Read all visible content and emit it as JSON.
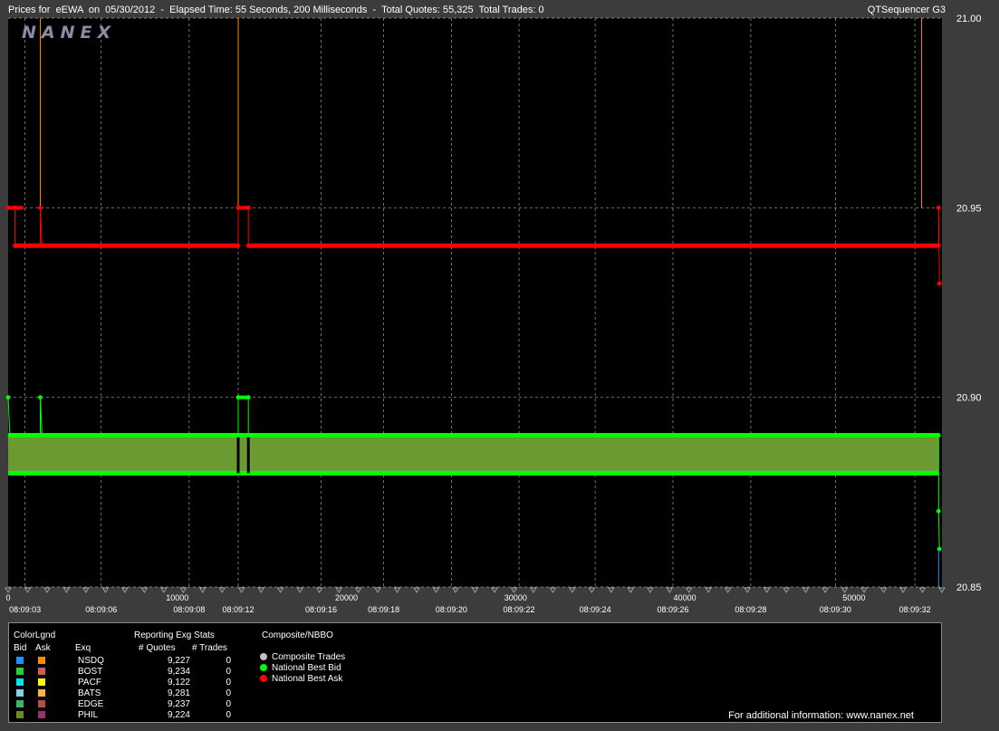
{
  "header": {
    "title": "Prices for  eEWA  on  05/30/2012  -  Elapsed Time: 55 Seconds, 200 Milliseconds  -  Total Quotes: 55,325  Total Trades: 0",
    "app_name": "QTSequencer G3",
    "watermark": "NANEX"
  },
  "colors": {
    "background": "#000000",
    "frame": "#3c3c3c",
    "bid_line": "#00ff00",
    "ask_line": "#ff0000",
    "spread_fill": "#6b9a32",
    "ask_spike": "#ff8c00",
    "grid": "#a0a0a0"
  },
  "chart_data": {
    "type": "line",
    "title": "",
    "xlabel": "",
    "ylabel": "",
    "x_range": [
      0,
      55200
    ],
    "ylim": [
      20.85,
      21.0
    ],
    "y_ticks": [
      "21.00",
      "20.95",
      "20.90",
      "20.85"
    ],
    "x_ticks_numeric": [
      0,
      10000,
      20000,
      30000,
      40000,
      50000
    ],
    "x_time_labels": [
      "08:09:03",
      "08:09:06",
      "08:09:08",
      "08:09:12",
      "08:09:16",
      "08:09:18",
      "08:09:20",
      "08:09:22",
      "08:09:24",
      "08:09:26",
      "08:09:28",
      "08:09:30",
      "08:09:32"
    ],
    "x_time_label_ms": [
      1000,
      5500,
      10700,
      13600,
      18500,
      22200,
      26200,
      30200,
      34700,
      39300,
      43900,
      48900,
      53600
    ],
    "grid": true,
    "series": [
      {
        "name": "National Best Ask",
        "color": "#ff0000",
        "points": [
          [
            0,
            20.95
          ],
          [
            400,
            20.95
          ],
          [
            400,
            20.94
          ],
          [
            1900,
            20.94
          ],
          [
            1900,
            20.95
          ],
          [
            2000,
            20.94
          ],
          [
            13600,
            20.94
          ],
          [
            13600,
            20.95
          ],
          [
            14200,
            20.95
          ],
          [
            14200,
            20.94
          ],
          [
            55000,
            20.94
          ],
          [
            55000,
            20.95
          ],
          [
            55050,
            20.93
          ]
        ]
      },
      {
        "name": "National Best Bid",
        "color": "#00ff00",
        "points": [
          [
            0,
            20.9
          ],
          [
            100,
            20.89
          ],
          [
            1900,
            20.89
          ],
          [
            1900,
            20.9
          ],
          [
            2000,
            20.89
          ],
          [
            13600,
            20.89
          ],
          [
            13600,
            20.9
          ],
          [
            14200,
            20.9
          ],
          [
            14200,
            20.89
          ],
          [
            55000,
            20.89
          ],
          [
            55000,
            20.87
          ],
          [
            55050,
            20.86
          ]
        ]
      },
      {
        "name": "Ask quote spikes",
        "color": "#ff8c00",
        "values_ms": [
          1900,
          13600,
          54000
        ]
      }
    ],
    "spread_band": {
      "upper": 20.89,
      "lower": 20.88,
      "color": "#6b9a32"
    }
  },
  "legend": {
    "color_header": "ColorLgnd",
    "bid_header": "Bid",
    "ask_header": "Ask",
    "exq_header": "Exq",
    "stats_header": "Reporting Exg Stats",
    "quotes_header": "# Quotes",
    "trades_header": "# Trades",
    "composite_header": "Composite/NBBO",
    "exchanges": [
      {
        "name": "NSDQ",
        "quotes": "9,227",
        "trades": "0",
        "bid_color": "#1e90ff",
        "ask_color": "#ff8c00"
      },
      {
        "name": "BOST",
        "quotes": "9,234",
        "trades": "0",
        "bid_color": "#32cd32",
        "ask_color": "#cd5c5c"
      },
      {
        "name": "PACF",
        "quotes": "9,122",
        "trades": "0",
        "bid_color": "#00e5ee",
        "ask_color": "#ffff00"
      },
      {
        "name": "BATS",
        "quotes": "9,281",
        "trades": "0",
        "bid_color": "#87ceeb",
        "ask_color": "#ffb347"
      },
      {
        "name": "EDGE",
        "quotes": "9,237",
        "trades": "0",
        "bid_color": "#3cb371",
        "ask_color": "#b05050"
      },
      {
        "name": "PHIL",
        "quotes": "9,224",
        "trades": "0",
        "bid_color": "#6b8e23",
        "ask_color": "#9b3070"
      }
    ],
    "composite_items": [
      {
        "label": "Composite Trades",
        "color": "#c0c0c0"
      },
      {
        "label": "National Best Bid",
        "color": "#00ff00"
      },
      {
        "label": "National Best Ask",
        "color": "#ff0000"
      }
    ],
    "footer": "For additional information: www.nanex.net"
  }
}
